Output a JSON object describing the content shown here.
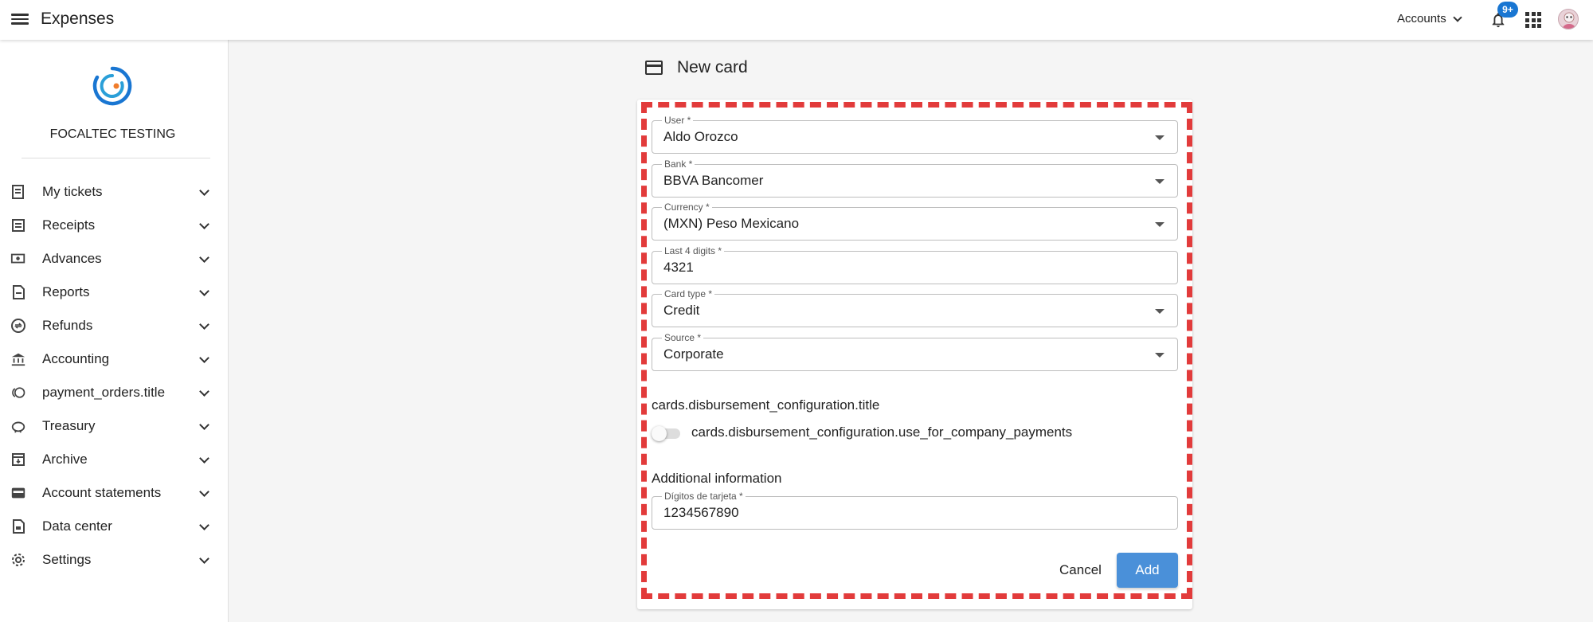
{
  "topbar": {
    "title": "Expenses",
    "accounts_label": "Accounts",
    "notifications_badge": "9+"
  },
  "sidebar": {
    "company": "FOCALTEC TESTING",
    "items": [
      {
        "label": "My tickets",
        "icon": "ticket-icon"
      },
      {
        "label": "Receipts",
        "icon": "receipt-icon"
      },
      {
        "label": "Advances",
        "icon": "money-icon"
      },
      {
        "label": "Reports",
        "icon": "report-icon"
      },
      {
        "label": "Refunds",
        "icon": "refund-icon"
      },
      {
        "label": "Accounting",
        "icon": "bank-icon"
      },
      {
        "label": "payment_orders.title",
        "icon": "coins-icon"
      },
      {
        "label": "Treasury",
        "icon": "piggy-bank-icon"
      },
      {
        "label": "Archive",
        "icon": "archive-icon"
      },
      {
        "label": "Account statements",
        "icon": "wallet-icon"
      },
      {
        "label": "Data center",
        "icon": "data-file-icon"
      },
      {
        "label": "Settings",
        "icon": "gear-icon"
      }
    ]
  },
  "main": {
    "page_title": "New card",
    "fields": [
      {
        "label": "User *",
        "value": "Aldo Orozco",
        "type": "select"
      },
      {
        "label": "Bank *",
        "value": "BBVA Bancomer",
        "type": "select"
      },
      {
        "label": "Currency *",
        "value": "(MXN) Peso Mexicano",
        "type": "select"
      },
      {
        "label": "Last 4 digits *",
        "value": "4321",
        "type": "text"
      },
      {
        "label": "Card type *",
        "value": "Credit",
        "type": "select"
      },
      {
        "label": "Source *",
        "value": "Corporate",
        "type": "select"
      }
    ],
    "disbursement_title": "cards.disbursement_configuration.title",
    "toggle_label": "cards.disbursement_configuration.use_for_company_payments",
    "additional_title": "Additional information",
    "extra_field": {
      "label": "Dígitos de tarjeta *",
      "value": "1234567890"
    },
    "cancel_label": "Cancel",
    "add_label": "Add"
  },
  "colors": {
    "primary_button": "#4a90d9",
    "badge": "#1976d2",
    "highlight": "#e23b3b"
  }
}
